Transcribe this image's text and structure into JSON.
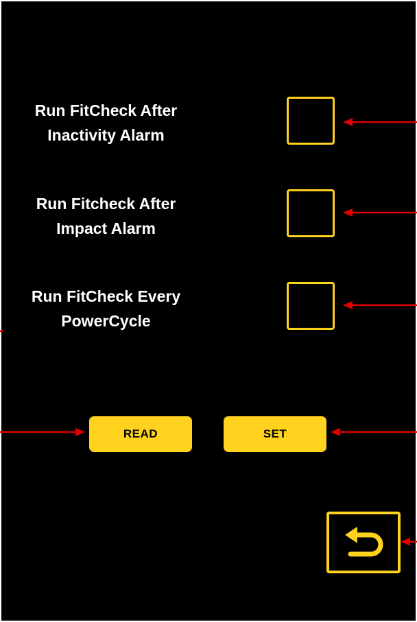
{
  "options": [
    {
      "label": "Run FitCheck After\nInactivity Alarm",
      "checked": false
    },
    {
      "label": "Run Fitcheck After\nImpact Alarm",
      "checked": false
    },
    {
      "label": "Run FitCheck Every\nPowerCycle",
      "checked": false
    }
  ],
  "buttons": {
    "read_label": "READ",
    "set_label": "SET"
  },
  "back_button": {
    "icon": "return-arrow-icon"
  },
  "colors": {
    "background": "#000000",
    "accent": "#FFD21E",
    "text": "#FFFFFF",
    "annotation_arrow": "#E00000"
  }
}
